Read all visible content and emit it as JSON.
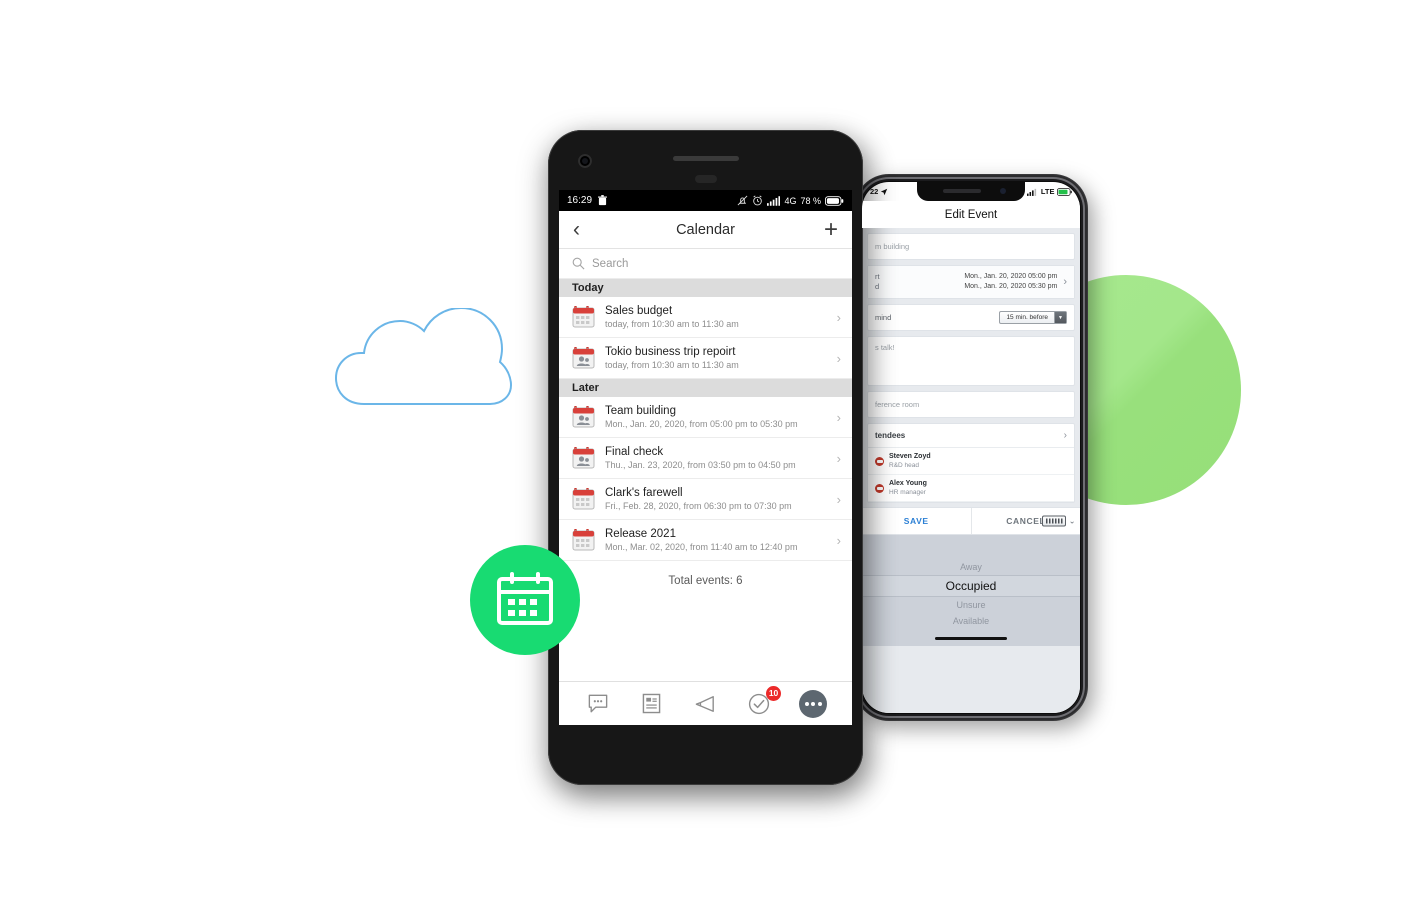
{
  "scene": {
    "background_color": "#ffffff",
    "cloud_color": "#6bb6e8",
    "green_circle_color": "#9ce382",
    "badge_circle_color": "#18db72"
  },
  "android": {
    "status_bar": {
      "time": "16:29",
      "trash_icon": "trash-icon",
      "mute_icon": "bell-muted-icon",
      "alarm_icon": "alarm-clock-icon",
      "signal_icon": "signal-bars-icon",
      "network": "4G",
      "battery_text": "78 %",
      "battery_icon": "battery-icon"
    },
    "nav": {
      "back_icon": "chevron-left-icon",
      "title": "Calendar",
      "add_icon": "plus-icon"
    },
    "search": {
      "icon": "search-icon",
      "placeholder": "Search",
      "value": ""
    },
    "sections": [
      {
        "header": "Today",
        "events": [
          {
            "icon": "calendar-grid-icon",
            "title": "Sales budget",
            "subtitle": "today, from 10:30 am to 11:30 am",
            "chevron": "chevron-right-icon"
          },
          {
            "icon": "calendar-people-icon",
            "title": "Tokio business trip repoirt",
            "subtitle": "today, from 10:30 am to 11:30 am",
            "chevron": "chevron-right-icon"
          }
        ]
      },
      {
        "header": "Later",
        "events": [
          {
            "icon": "calendar-people-icon",
            "title": "Team building",
            "subtitle": "Mon., Jan. 20, 2020, from 05:00 pm to 05:30 pm",
            "chevron": "chevron-right-icon"
          },
          {
            "icon": "calendar-people-icon",
            "title": "Final check",
            "subtitle": "Thu., Jan. 23, 2020, from 03:50 pm to 04:50 pm",
            "chevron": "chevron-right-icon"
          },
          {
            "icon": "calendar-grid-icon",
            "title": "Clark's farewell",
            "subtitle": "Fri., Feb. 28, 2020, from 06:30 pm to 07:30 pm",
            "chevron": "chevron-right-icon"
          },
          {
            "icon": "calendar-grid-icon",
            "title": "Release 2021",
            "subtitle": "Mon., Mar. 02, 2020, from 11:40 am to 12:40 pm",
            "chevron": "chevron-right-icon"
          }
        ]
      }
    ],
    "total_label": "Total events: 6",
    "tabs": [
      {
        "name": "chat",
        "icon": "chat-bubble-icon",
        "badge": ""
      },
      {
        "name": "documents",
        "icon": "document-icon",
        "badge": ""
      },
      {
        "name": "announcements",
        "icon": "megaphone-icon",
        "badge": ""
      },
      {
        "name": "tasks",
        "icon": "check-circle-icon",
        "badge": "10"
      },
      {
        "name": "more",
        "icon": "more-dots-icon",
        "badge": ""
      }
    ]
  },
  "iphone": {
    "status_bar": {
      "time": "22",
      "location_icon": "location-arrow-icon",
      "signal_icon": "signal-bars-icon",
      "network": "LTE",
      "battery_icon": "battery-icon"
    },
    "title": "Edit Event",
    "name_field": {
      "value": "m building",
      "placeholder": "Team building"
    },
    "date_row": {
      "start_label": "rt",
      "end_label": "d",
      "start_value": "Mon., Jan. 20, 2020 05:00 pm",
      "end_value": "Mon., Jan. 20, 2020 05:30 pm",
      "chevron": "chevron-right-icon"
    },
    "reminder": {
      "label": "mind",
      "selected": "15 min. before",
      "dropdown_icon": "caret-down-icon"
    },
    "description": {
      "value": "s talk!"
    },
    "location": {
      "value": "ference room"
    },
    "attendees": {
      "header": "tendees",
      "chevron": "chevron-right-icon",
      "people": [
        {
          "avatar": "avatar-icon",
          "name": "Steven Zoyd",
          "role": "R&D head"
        },
        {
          "avatar": "avatar-icon",
          "name": "Alex Young",
          "role": "HR manager"
        }
      ]
    },
    "actions": {
      "save": "SAVE",
      "cancel": "CANCEL",
      "keyboard_icon": "keyboard-icon",
      "collapse_icon": "chevron-down-icon"
    },
    "picker": {
      "options": [
        "Away",
        "Occupied",
        "Unsure",
        "Available"
      ],
      "selected": "Occupied"
    }
  }
}
